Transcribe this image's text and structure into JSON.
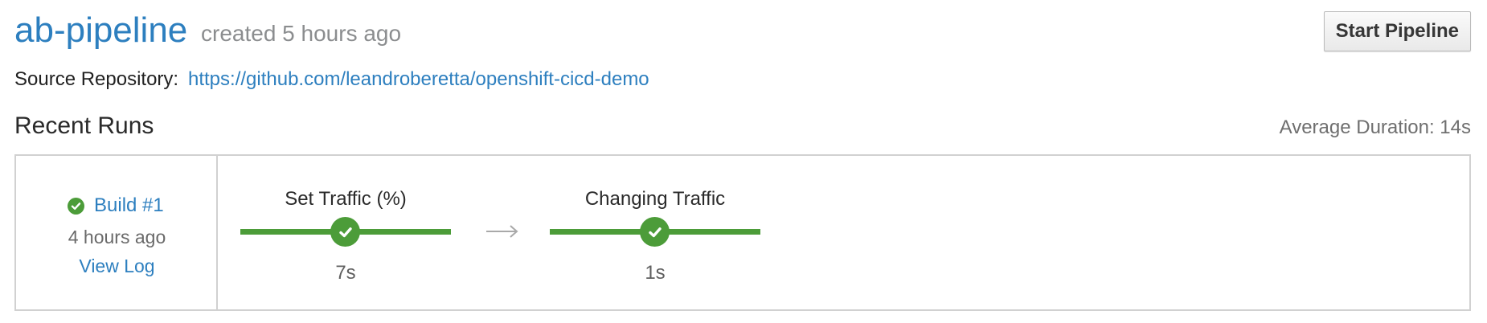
{
  "header": {
    "pipeline_name": "ab-pipeline",
    "created": "created 5 hours ago",
    "start_button": "Start Pipeline"
  },
  "source": {
    "label": "Source Repository:",
    "url": "https://github.com/leandroberetta/openshift-cicd-demo"
  },
  "recent_runs": {
    "title": "Recent Runs",
    "average_duration": "Average Duration: 14s",
    "builds": [
      {
        "label": "Build #1",
        "status_icon": "check-circle-icon",
        "time_ago": "4 hours ago",
        "view_log": "View Log",
        "stages": [
          {
            "name": "Set Traffic (%)",
            "duration": "7s",
            "status": "success"
          },
          {
            "name": "Changing Traffic",
            "duration": "1s",
            "status": "success"
          }
        ]
      }
    ]
  },
  "colors": {
    "link": "#2d7fbf",
    "success": "#4c9c39",
    "border": "#d1d1d1"
  }
}
